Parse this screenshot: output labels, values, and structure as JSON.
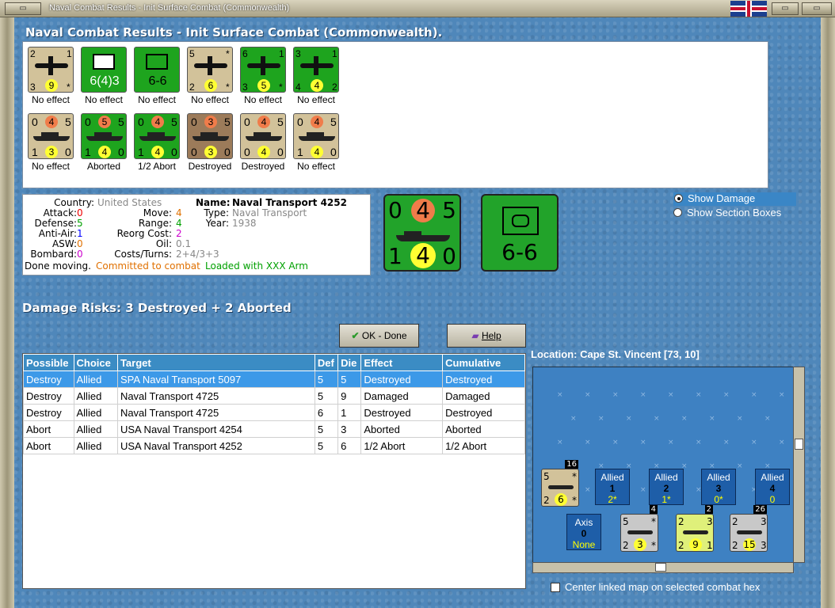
{
  "window": {
    "title": "Naval Combat Results - Init Surface Combat (Commonwealth)"
  },
  "header": {
    "title": "Naval Combat Results - Init Surface Combat (Commonwealth)."
  },
  "results_row1": [
    {
      "type": "plane",
      "tl": "2",
      "tr": "1",
      "bl": "3",
      "br": "*",
      "circle": "9",
      "circle_color": "yellow",
      "bg": "#d2c29a",
      "label": "No effect"
    },
    {
      "type": "box",
      "main": "6(4)3",
      "bg": "#1ea41e",
      "label": "No effect"
    },
    {
      "type": "box2",
      "main": "6-6",
      "bg": "#1ea41e",
      "label": "No effect"
    },
    {
      "type": "plane2",
      "tl": "5",
      "tr": "*",
      "bl": "2",
      "br": "*",
      "circle": "6",
      "circle_color": "yellow",
      "bg": "#d2c29a",
      "label": "No effect"
    },
    {
      "type": "plane",
      "tl": "6",
      "tr": "1",
      "bl": "3",
      "br": "*",
      "circle": "5",
      "circle_color": "yellow",
      "bg": "#1ea41e",
      "label": "No effect"
    },
    {
      "type": "plane",
      "tl": "3",
      "tr": "1",
      "bl": "4",
      "br": "2",
      "circle": "4",
      "circle_color": "yellow",
      "bg": "#1ea41e",
      "label": "No effect"
    }
  ],
  "results_row2": [
    {
      "tl": "0",
      "top": "4",
      "tr": "5",
      "bl": "1",
      "circle": "3",
      "br": "0",
      "bg": "#d2c29a",
      "label": "No effect"
    },
    {
      "tl": "0",
      "top": "5",
      "tr": "5",
      "bl": "1",
      "circle": "4",
      "br": "0",
      "bg": "#1ea41e",
      "label": "Aborted"
    },
    {
      "tl": "0",
      "top": "4",
      "tr": "5",
      "bl": "1",
      "circle": "4",
      "br": "0",
      "bg": "#1ea41e",
      "label": "1/2 Abort"
    },
    {
      "tl": "0",
      "top": "3",
      "tr": "5",
      "bl": "0",
      "circle": "3",
      "br": "0",
      "bg": "#9c7b5a",
      "label": "Destroyed"
    },
    {
      "tl": "0",
      "top": "4",
      "tr": "5",
      "bl": "0",
      "circle": "4",
      "br": "0",
      "bg": "#d2c29a",
      "label": "Destroyed"
    },
    {
      "tl": "0",
      "top": "4",
      "tr": "5",
      "bl": "1",
      "circle": "4",
      "br": "0",
      "bg": "#d2c29a",
      "label": "No effect"
    }
  ],
  "info": {
    "country_label": "Country:",
    "country": "United States",
    "attack_label": "Attack:",
    "attack": "0",
    "defense_label": "Defense:",
    "defense": "5",
    "antiair_label": "Anti-Air:",
    "antiair": "1",
    "asw_label": "ASW:",
    "asw": "0",
    "bombard_label": "Bombard:",
    "bombard": "0",
    "move_label": "Move:",
    "move": "4",
    "range_label": "Range:",
    "range": "4",
    "reorg_label": "Reorg Cost:",
    "reorg": "2",
    "oil_label": "Oil:",
    "oil": "0.1",
    "costs_label": "Costs/Turns:",
    "costs": "2+4/3+3",
    "name_label": "Name:",
    "name": "Naval Transport 4252",
    "type_label": "Type:",
    "type": "Naval Transport",
    "year_label": "Year:",
    "year": "1938",
    "status1": "Done moving.",
    "status2": "Committed to combat",
    "status3": "Loaded with XXX Arm"
  },
  "big_chip": {
    "tl": "0",
    "top": "4",
    "tr": "5",
    "bl": "1",
    "circle": "4",
    "br": "0"
  },
  "big_box": {
    "main": "6-6"
  },
  "options": {
    "show_damage": "Show Damage",
    "show_boxes": "Show Section Boxes"
  },
  "damage_risks": "Damage Risks: 3 Destroyed + 2 Aborted",
  "buttons": {
    "ok": "OK - Done",
    "help": "Help"
  },
  "table": {
    "headers": [
      "Possible",
      "Choice",
      "Target",
      "Def",
      "Die",
      "Effect",
      "Cumulative"
    ],
    "rows": [
      [
        "Destroy",
        "Allied",
        "SPA Naval Transport 5097",
        "5",
        "5",
        "Destroyed",
        "Destroyed"
      ],
      [
        "Destroy",
        "Allied",
        " Naval Transport 4725",
        "5",
        "9",
        "Damaged",
        "Damaged"
      ],
      [
        "Destroy",
        "Allied",
        " Naval Transport 4725",
        "6",
        "1",
        "Destroyed",
        "Destroyed"
      ],
      [
        "Abort",
        "Allied",
        "USA Naval Transport 4254",
        "5",
        "3",
        "Aborted",
        "Aborted"
      ],
      [
        "Abort",
        "Allied",
        "USA Naval Transport 4252",
        "5",
        "6",
        "1/2 Abort",
        "1/2 Abort"
      ]
    ]
  },
  "location": "Location:  Cape St. Vincent [73, 10]",
  "map": {
    "allied": [
      {
        "label": "Allied",
        "num": "1",
        "val": "2*"
      },
      {
        "label": "Allied",
        "num": "2",
        "val": "1*"
      },
      {
        "label": "Allied",
        "num": "3",
        "val": "0*"
      },
      {
        "label": "Allied",
        "num": "4",
        "val": "0"
      }
    ],
    "axis": {
      "label": "Axis",
      "num": "0",
      "val": "None"
    },
    "chips": [
      {
        "count": "16",
        "tl": "5",
        "tr": "*",
        "bl": "2",
        "circle": "6",
        "br": "*",
        "bg": "#d2c29a"
      },
      {
        "count": "4",
        "tl": "5",
        "tr": "*",
        "bl": "2",
        "circle": "3",
        "br": "*",
        "bg": "#c8c8c8"
      },
      {
        "count": "2",
        "tl": "2",
        "tr": "3",
        "bl": "2",
        "circle": "9",
        "br": "1",
        "bg": "#dff07a"
      },
      {
        "count": "26",
        "tl": "2",
        "tr": "3",
        "bl": "2",
        "circle": "15",
        "br": "3",
        "bg": "#c8c8c8"
      }
    ]
  },
  "center_map": "Center linked map on selected combat hex"
}
